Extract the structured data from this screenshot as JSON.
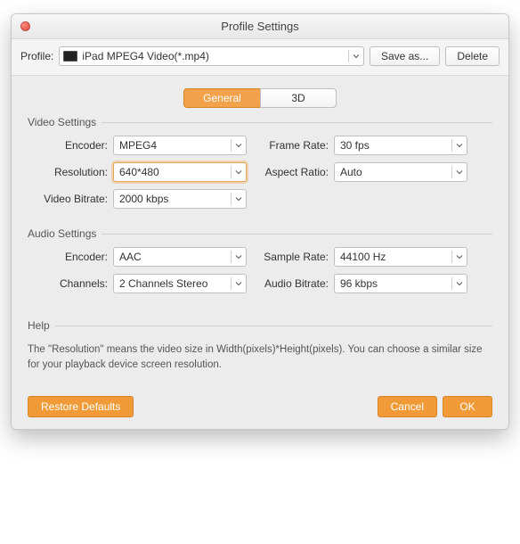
{
  "window": {
    "title": "Profile Settings"
  },
  "profile_row": {
    "label": "Profile:",
    "selected": "iPad MPEG4 Video(*.mp4)",
    "save_as": "Save as...",
    "delete": "Delete"
  },
  "tabs": {
    "general": "General",
    "three_d": "3D"
  },
  "video_settings": {
    "legend": "Video Settings",
    "encoder_label": "Encoder:",
    "encoder_value": "MPEG4",
    "resolution_label": "Resolution:",
    "resolution_value": "640*480",
    "bitrate_label": "Video Bitrate:",
    "bitrate_value": "2000 kbps",
    "framerate_label": "Frame Rate:",
    "framerate_value": "30 fps",
    "aspect_label": "Aspect Ratio:",
    "aspect_value": "Auto"
  },
  "audio_settings": {
    "legend": "Audio Settings",
    "encoder_label": "Encoder:",
    "encoder_value": "AAC",
    "channels_label": "Channels:",
    "channels_value": "2 Channels Stereo",
    "samplerate_label": "Sample Rate:",
    "samplerate_value": "44100 Hz",
    "abitrate_label": "Audio Bitrate:",
    "abitrate_value": "96 kbps"
  },
  "help": {
    "legend": "Help",
    "text": "The \"Resolution\" means the video size in Width(pixels)*Height(pixels).  You can choose a similar size for your playback device screen resolution."
  },
  "footer": {
    "restore": "Restore Defaults",
    "cancel": "Cancel",
    "ok": "OK"
  }
}
